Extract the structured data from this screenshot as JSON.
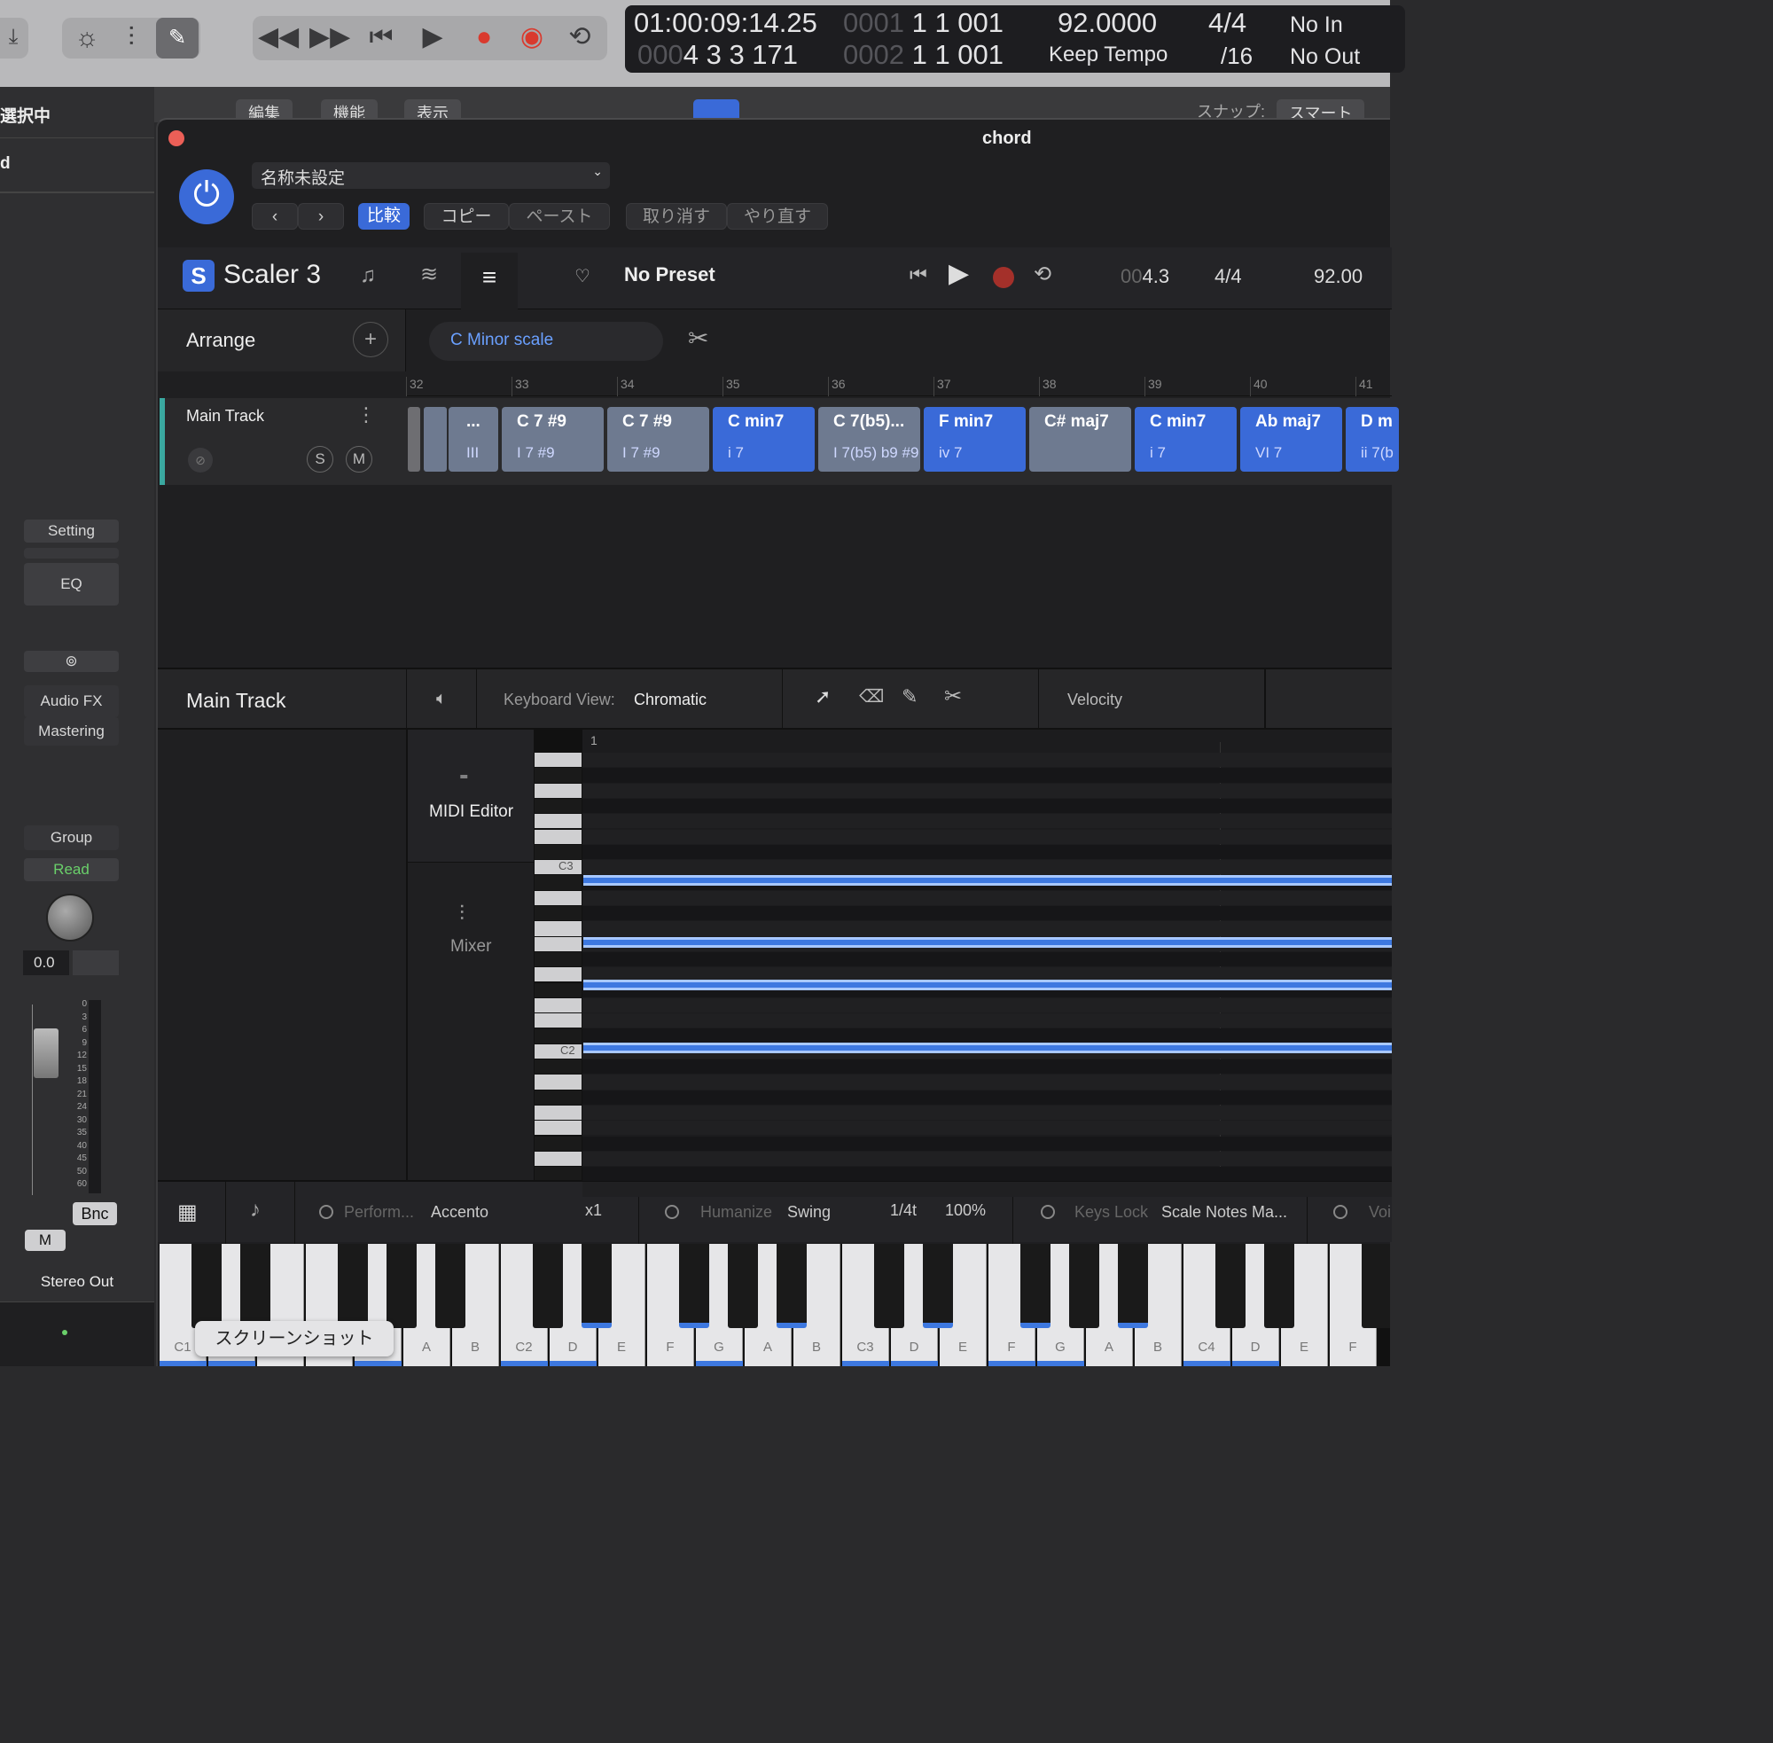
{
  "transport_lcd": {
    "smpte": "01:00:09:14.25",
    "bars_dim": "000",
    "bars": "4  3  3  171",
    "pos1_dim": "0001",
    "pos1": "1  1  001",
    "pos2_dim": "0002",
    "pos2": "1  1  001",
    "tempo": "92.0000",
    "tempo_mode": "Keep Tempo",
    "sig_top": "4/4",
    "sig_bottom": "/16",
    "midi_in": "No In",
    "midi_out": "No Out"
  },
  "logic_bar": {
    "edit_menu": "編集",
    "function_menu": "機能",
    "view_menu": "表示",
    "snap_label": "スナップ:",
    "snap_value": "スマート"
  },
  "left_strip": {
    "selected_text": "選択中",
    "track_text": "d",
    "setting": "Setting",
    "eq": "EQ",
    "link_icon": "link-icon",
    "audio_fx": "Audio FX",
    "mastering": "Mastering",
    "group": "Group",
    "automation": "Read",
    "pan_value": "0.0",
    "meter_scale": [
      "0",
      "3",
      "6",
      "9",
      "12",
      "15",
      "18",
      "21",
      "24",
      "30",
      "35",
      "40",
      "45",
      "50",
      "60"
    ],
    "bounce": "Bnc",
    "mute": "M",
    "output": "Stereo Out"
  },
  "plugin_window": {
    "title": "chord",
    "preset_name": "名称未設定",
    "compare": "比較",
    "copy": "コピー",
    "paste": "ペースト",
    "undo": "取り消す",
    "redo": "やり直す"
  },
  "scaler": {
    "app_name": "Scaler 3",
    "preset": "No Preset",
    "position_dim": "00",
    "position": "4.3",
    "time_sig": "4/4",
    "tempo": "92.00",
    "arrange_label": "Arrange",
    "scale_pill": "C Minor scale",
    "ruler": [
      "32",
      "33",
      "34",
      "35",
      "36",
      "37",
      "38",
      "39",
      "40",
      "41"
    ],
    "track_name": "Main Track",
    "solo": "S",
    "mute": "M",
    "chords": [
      {
        "name": "...",
        "roman": "III",
        "color": "grey"
      },
      {
        "name": "C 7 #9",
        "roman": "I 7 #9",
        "color": "grey"
      },
      {
        "name": "C 7 #9",
        "roman": "I 7 #9",
        "color": "grey"
      },
      {
        "name": "C min7",
        "roman": "i 7",
        "color": "blue"
      },
      {
        "name": "C 7(b5)...",
        "roman": "I 7(b5) b9 #9",
        "color": "grey"
      },
      {
        "name": "F min7",
        "roman": "iv 7",
        "color": "blue"
      },
      {
        "name": "C# maj7",
        "roman": "",
        "color": "grey"
      },
      {
        "name": "C min7",
        "roman": "i 7",
        "color": "blue"
      },
      {
        "name": "Ab maj7",
        "roman": "VI 7",
        "color": "blue"
      },
      {
        "name": "D m",
        "roman": "ii 7(b",
        "color": "blue"
      }
    ],
    "editor": {
      "track_name": "Main Track",
      "keyboard_view_label": "Keyboard View:",
      "keyboard_view_value": "Chromatic",
      "velocity": "Velocity",
      "ruler_start": "1",
      "midi_editor": "MIDI Editor",
      "mixer": "Mixer",
      "c3": "C3",
      "c2": "C2"
    },
    "bottom": {
      "perform_label": "Perform...",
      "perform_value": "Accento",
      "perform_mult": "x1",
      "humanize_label": "Humanize",
      "humanize_value": "Swing",
      "humanize_div": "1/4t",
      "humanize_pct": "100%",
      "keyslock_label": "Keys Lock",
      "keyslock_value": "Scale Notes Ma...",
      "voice_label": "Voi"
    },
    "keyboard_labels": [
      "C1",
      "D",
      "E",
      "F",
      "G",
      "A",
      "B",
      "C2",
      "D",
      "E",
      "F",
      "G",
      "A",
      "B",
      "C3",
      "D",
      "E",
      "F",
      "G",
      "A",
      "B",
      "C4",
      "D",
      "E",
      "F"
    ],
    "screenshot_tooltip": "スクリーンショット"
  }
}
